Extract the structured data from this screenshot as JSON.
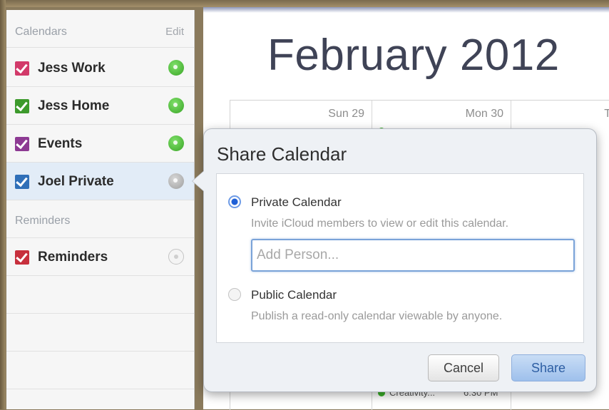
{
  "sidebar": {
    "calendars_header": "Calendars",
    "edit_label": "Edit",
    "calendars": [
      {
        "name": "Jess Work",
        "color": "#d23a6a",
        "shared": "green"
      },
      {
        "name": "Jess Home",
        "color": "#3d9a2c",
        "shared": "green"
      },
      {
        "name": "Events",
        "color": "#8d3a93",
        "shared": "green"
      },
      {
        "name": "Joel Private",
        "color": "#2f6fb8",
        "shared": "gray",
        "selected": true
      }
    ],
    "reminders_header": "Reminders",
    "reminders": [
      {
        "name": "Reminders",
        "color": "#c7303d",
        "shared": "outline"
      }
    ]
  },
  "calendar": {
    "month_title": "February 2012",
    "days": [
      "Sun 29",
      "Mon 30",
      "T"
    ],
    "bottom_event": {
      "title": "Creativity...",
      "time": "6:30 PM"
    }
  },
  "share_dialog": {
    "title": "Share Calendar",
    "private_label": "Private Calendar",
    "private_desc": "Invite iCloud members to view or edit this calendar.",
    "add_person_placeholder": "Add Person...",
    "add_person_value": "",
    "public_label": "Public Calendar",
    "public_desc": "Publish a read-only calendar viewable by anyone.",
    "cancel_label": "Cancel",
    "share_label": "Share",
    "selected_option": "private"
  },
  "colors": {
    "accent": "#1d5fd6",
    "share_button": "#9ec0ec"
  }
}
